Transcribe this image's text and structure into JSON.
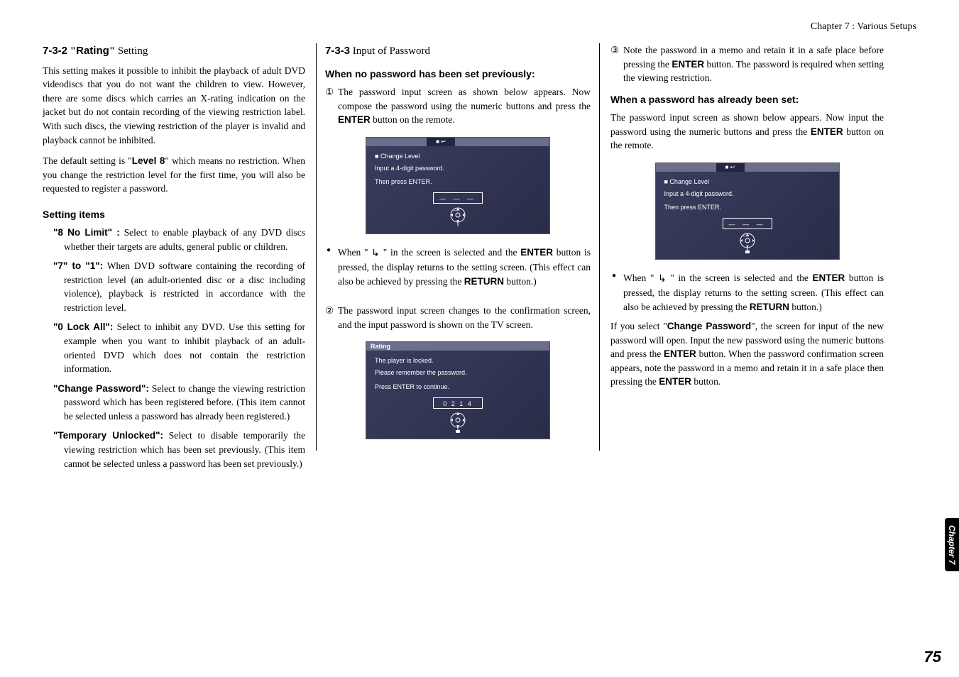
{
  "header": {
    "chapter": "Chapter 7 : Various Setups"
  },
  "col1": {
    "title_num": "7-3-2",
    "title_quoted": "Rating",
    "title_suffix": " Setting",
    "p1": "This setting makes it possible to inhibit the playback of adult DVD videodiscs that you do not want the children to view. However, there are some discs which carries an X-rating indication on the jacket but do not contain recording of the viewing restriction label. With such discs, the viewing restriction of the player is invalid and playback cannot be inhibited.",
    "p2a": "The default setting is \"",
    "p2b": "Level 8",
    "p2c": "\" which means no restriction. When you change the restriction level for the first time, you will also be requested to register a password.",
    "items_title": "Setting items",
    "items": [
      {
        "label": "\"8 No Limit\" :",
        "text": " Select to enable playback of any DVD discs whether their targets are adults, general public or children."
      },
      {
        "label": "\"7\" to \"1\":",
        "text": " When DVD software containing the recording of restriction level (an adult-oriented disc or a disc including violence), playback is restricted in accordance with the restriction level."
      },
      {
        "label": "\"0 Lock All\":",
        "text": "  Select to inhibit any DVD. Use this setting for example when you want to inhibit playback of an adult-oriented DVD which does not contain the restriction information."
      },
      {
        "label": "\"Change Password\":",
        "text": " Select to change the viewing restriction password which has been registered before. (This item cannot be selected unless a password has already been registered.)"
      },
      {
        "label": "\"Temporary Unlocked\":",
        "text": " Select to disable temporarily the viewing restriction which has been set previously. (This item cannot be selected unless a password has been set previously.)"
      }
    ]
  },
  "col2": {
    "title_num": "7-3-3",
    "title_suffix": "  Input of Password",
    "sub1": "When no password has been set previously:",
    "p1a": "The password input screen as shown below appears. Now compose the password using the numeric buttons and press the ",
    "p1b": "ENTER",
    "p1c": " button on the remote.",
    "osd1": {
      "line1": "■ Change Level",
      "line2": "Input a 4-digit password.",
      "line3": "Then press ENTER.",
      "input": "— — — —",
      "tab": "■     ↩"
    },
    "b1a": "When \" ",
    "b1b": " \" in the screen is selected and the ",
    "b1c": "ENTER",
    "b1d": " button is pressed, the display returns to the setting screen. (This effect can also be achieved by pressing the ",
    "b1e": "RETURN",
    "b1f": " button.)",
    "p2": "The password input screen changes to the confirmation screen, and the input password is shown on the TV screen.",
    "osd2": {
      "title": "Rating",
      "line1": "The player is locked.",
      "line2": "Please remember the password.",
      "line3": "Press ENTER to continue.",
      "input": "0  2  1  4"
    }
  },
  "col3": {
    "p1a": "Note the password in a memo and retain it in a safe place before pressing the ",
    "p1b": "ENTER",
    "p1c": " button. The password is required when setting the viewing restriction.",
    "sub2": "When a password has already been set:",
    "p2a": "The password input screen as shown below appears. Now input the password using the numeric buttons and press the ",
    "p2b": "ENTER",
    "p2c": " button on the remote.",
    "osd3": {
      "line1": "■ Change Level",
      "line2": "Input a 4-digit password.",
      "line3": "Then press ENTER.",
      "input": "— — — —",
      "tab": "■     ↩"
    },
    "b1a": "When \" ",
    "b1b": " \" in the screen is selected and the ",
    "b1c": "ENTER",
    "b1d": " button is pressed, the display returns to the setting screen. (This effect can also be achieved by pressing the ",
    "b1e": "RETURN",
    "b1f": " button.)",
    "p3a": "If you select \"",
    "p3b": "Change Password",
    "p3c": "\", the screen for input of the new password will open. Input the new password using the numeric buttons and press the ",
    "p3d": "ENTER",
    "p3e": " button. When the password confirmation screen appears, note the password in a memo and retain it in a safe place then pressing the ",
    "p3f": "ENTER",
    "p3g": " button."
  },
  "sidetab": "Chapter 7",
  "pagenum": "75"
}
